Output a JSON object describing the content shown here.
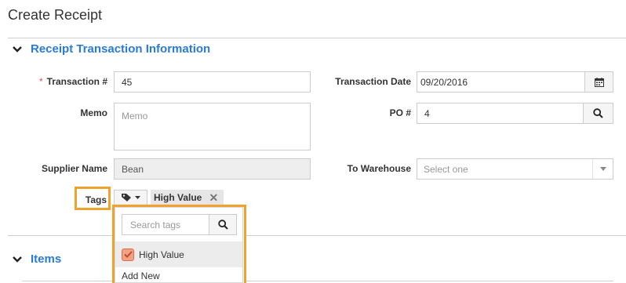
{
  "page": {
    "title": "Create Receipt"
  },
  "section_receipt": {
    "title": "Receipt Transaction Information"
  },
  "fields": {
    "transaction": {
      "required_mark": "*",
      "label": "Transaction #",
      "value": "45"
    },
    "memo": {
      "label": "Memo",
      "placeholder": "Memo"
    },
    "supplier": {
      "label": "Supplier Name",
      "value": "Bean"
    },
    "tags": {
      "label": "Tags",
      "selected": [
        "High Value"
      ],
      "remove_glyph": "✕"
    },
    "transaction_date": {
      "label": "Transaction Date",
      "value": "09/20/2016"
    },
    "po": {
      "label": "PO #",
      "value": "4"
    },
    "warehouse": {
      "label": "To Warehouse",
      "placeholder": "Select one"
    }
  },
  "tag_dropdown": {
    "search_placeholder": "Search tags",
    "items": [
      {
        "label": "High Value",
        "checked": true
      }
    ],
    "add_new": "Add New"
  },
  "section_items": {
    "title": "Items"
  },
  "colors": {
    "accent": "#2a7bd6",
    "highlight": "#f0a22e",
    "required": "#d9534f"
  },
  "icons": [
    "chevron-down-icon",
    "calendar-icon",
    "search-icon",
    "tag-icon",
    "caret-down-icon",
    "close-icon",
    "checkbox-checked-icon"
  ]
}
